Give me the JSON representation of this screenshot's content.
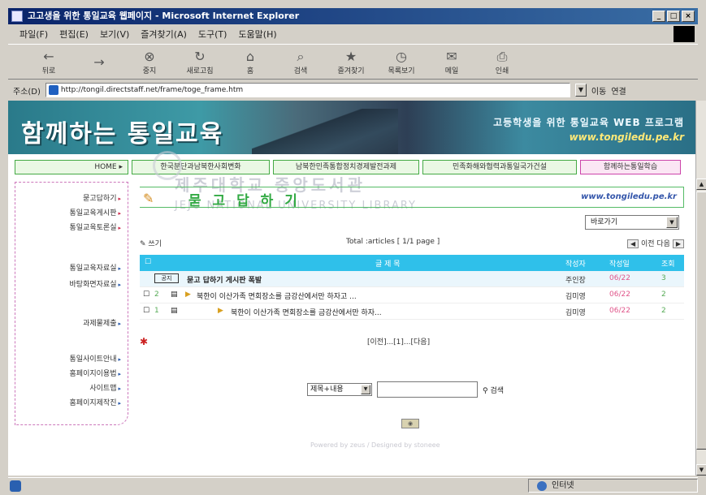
{
  "window": {
    "title": "고고생을 위한 통일교육 웹페이지 - Microsoft Internet Explorer",
    "controls": [
      "_",
      "□",
      "×"
    ]
  },
  "menubar": [
    "파일(F)",
    "편집(E)",
    "보기(V)",
    "즐겨찾기(A)",
    "도구(T)",
    "도움말(H)"
  ],
  "toolbar": [
    {
      "label": "뒤로",
      "icon": "back-icon"
    },
    {
      "label": "",
      "icon": "forward-icon"
    },
    {
      "label": "중지",
      "icon": "stop-icon"
    },
    {
      "label": "새로고침",
      "icon": "refresh-icon"
    },
    {
      "label": "홈",
      "icon": "home-icon"
    },
    {
      "label": "검색",
      "icon": "search-icon"
    },
    {
      "label": "즐겨찾기",
      "icon": "favorites-icon"
    },
    {
      "label": "목록보기",
      "icon": "history-icon"
    },
    {
      "label": "메일",
      "icon": "mail-icon"
    },
    {
      "label": "인쇄",
      "icon": "print-icon"
    }
  ],
  "address": {
    "label": "주소(D)",
    "url": "http://tongil.directstaff.net/frame/toge_frame.htm",
    "go": "이동",
    "links": "연결"
  },
  "banner": {
    "title": "함께하는 통일교육",
    "subtitle": "고등학생을 위한 통일교육 WEB 프로그램",
    "url": "www.tongiledu.pe.kr"
  },
  "nav": {
    "home": "HOME ▸",
    "tabs": [
      "한국분단과남북한사회변화",
      "남북한민족통합정치경제발전과제",
      "민족화해와협력과통일국가건설",
      "함께하는통일학습"
    ]
  },
  "leftmenu": [
    {
      "label": "묻고답하기",
      "arrow": "▸"
    },
    {
      "label": "통일교육게시판",
      "arrow": "▸"
    },
    {
      "label": "통일교육토론실",
      "arrow": "▸"
    },
    {
      "label": "통일교육자료실",
      "arrow": "▸"
    },
    {
      "label": "바탕화면자료실",
      "arrow": "▸"
    },
    {
      "label": "과제물제출",
      "arrow": "▸"
    },
    {
      "label": "통일사이트안내",
      "arrow": "▸"
    },
    {
      "label": "홈페이지이용법",
      "arrow": "▸"
    },
    {
      "label": "사이트맵",
      "arrow": "▸"
    },
    {
      "label": "홈페이지제작진",
      "arrow": "▸"
    }
  ],
  "watermark": {
    "line1": "제주대학교 중앙도서관",
    "line2": "JEJU NATIONAL UNIVERSITY LIBRARY"
  },
  "page": {
    "heading": "묻 고 답 하 기",
    "url": "www.tongiledu.pe.kr",
    "move_select": "바로가기",
    "write": "쓰기",
    "total": "Total :articles [ 1/1 page ]",
    "prev_next": "이전  다음"
  },
  "board": {
    "headers": {
      "title": "글 제 목",
      "author": "작성자",
      "date": "작성일",
      "views": "조회"
    },
    "notice": {
      "tag": "공지",
      "title": "묻고 답하기 게시판 폭발",
      "author": "주인장",
      "date": "06/22",
      "views": "3"
    },
    "rows": [
      {
        "num": "2",
        "title": "북한이 이산가족 면회장소를 금강산에서만 하자고 ...",
        "author": "김미영",
        "date": "06/22",
        "views": "2"
      },
      {
        "num": "1",
        "title": "북한이 이산가족 면회장소를 금강산에서만 하자...",
        "author": "김미영",
        "date": "06/22",
        "views": "2"
      }
    ]
  },
  "pager": "[이전]...[1]...[다음]",
  "search": {
    "field": "제목+내용",
    "button": "검색"
  },
  "footer": {
    "powered": "Powered by zeus / Designed by  stoneee"
  },
  "status": {
    "zone": "인터넷"
  }
}
